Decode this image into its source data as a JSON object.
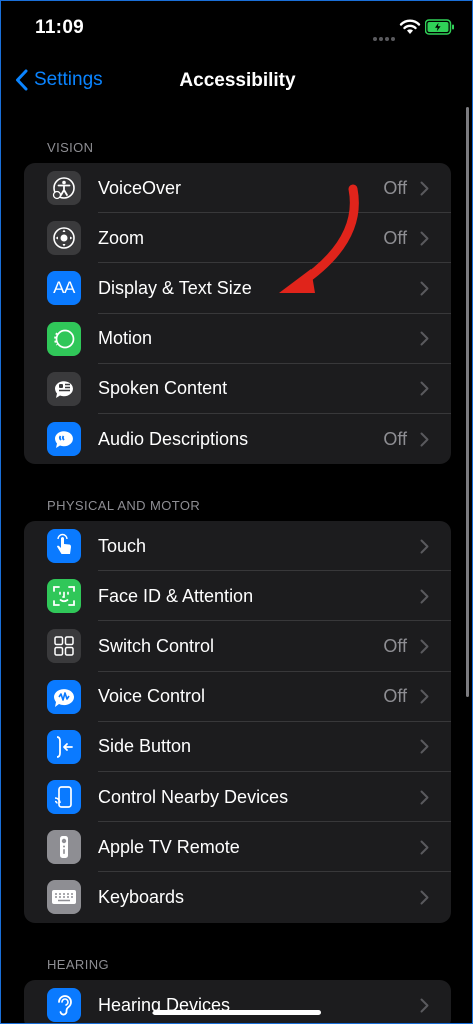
{
  "status": {
    "time": "11:09"
  },
  "nav": {
    "back_label": "Settings",
    "title": "Accessibility"
  },
  "sections": [
    {
      "header": "VISION",
      "items": [
        {
          "label": "VoiceOver",
          "value": "Off",
          "icon": "voiceover-icon",
          "color": "#3a3a3c"
        },
        {
          "label": "Zoom",
          "value": "Off",
          "icon": "zoom-icon",
          "color": "#3a3a3c"
        },
        {
          "label": "Display & Text Size",
          "value": "",
          "icon": "display-text-size-icon",
          "color": "#0a7aff"
        },
        {
          "label": "Motion",
          "value": "",
          "icon": "motion-icon",
          "color": "#30c759"
        },
        {
          "label": "Spoken Content",
          "value": "",
          "icon": "spoken-content-icon",
          "color": "#3a3a3c"
        },
        {
          "label": "Audio Descriptions",
          "value": "Off",
          "icon": "audio-descriptions-icon",
          "color": "#0a7aff"
        }
      ]
    },
    {
      "header": "PHYSICAL AND MOTOR",
      "items": [
        {
          "label": "Touch",
          "value": "",
          "icon": "touch-icon",
          "color": "#0a7aff"
        },
        {
          "label": "Face ID & Attention",
          "value": "",
          "icon": "face-id-icon",
          "color": "#30c759"
        },
        {
          "label": "Switch Control",
          "value": "Off",
          "icon": "switch-control-icon",
          "color": "#3a3a3c"
        },
        {
          "label": "Voice Control",
          "value": "Off",
          "icon": "voice-control-icon",
          "color": "#0a7aff"
        },
        {
          "label": "Side Button",
          "value": "",
          "icon": "side-button-icon",
          "color": "#0a7aff"
        },
        {
          "label": "Control Nearby Devices",
          "value": "",
          "icon": "control-nearby-devices-icon",
          "color": "#0a7aff"
        },
        {
          "label": "Apple TV Remote",
          "value": "",
          "icon": "apple-tv-remote-icon",
          "color": "#8e8e93"
        },
        {
          "label": "Keyboards",
          "value": "",
          "icon": "keyboard-icon",
          "color": "#8e8e93"
        }
      ]
    },
    {
      "header": "HEARING",
      "items": [
        {
          "label": "Hearing Devices",
          "value": "",
          "icon": "hearing-devices-icon",
          "color": "#0a7aff"
        }
      ]
    }
  ],
  "colors": {
    "accent": "#0a84ff",
    "annotation_arrow": "#e0241b",
    "battery": "#30d158"
  }
}
